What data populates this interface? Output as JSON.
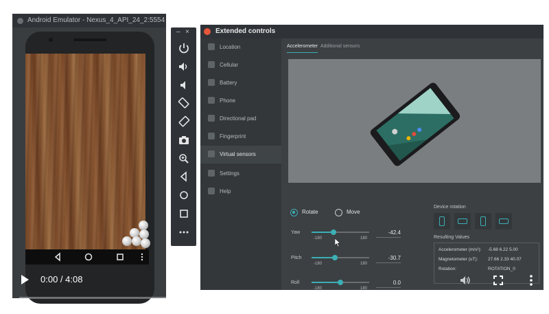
{
  "emulator": {
    "title": "Android Emulator - Nexus_4_API_24_2:5554"
  },
  "toolbar": {
    "minimize": "–",
    "close": "×",
    "buttons": [
      "power-icon",
      "volume-up-icon",
      "volume-down-icon",
      "rotate-left-icon",
      "rotate-right-icon",
      "camera-icon",
      "zoom-icon",
      "back-icon",
      "home-icon",
      "overview-icon",
      "more-icon"
    ]
  },
  "extended_controls": {
    "title": "Extended controls",
    "sidebar": [
      {
        "label": "Location",
        "icon": "location-icon"
      },
      {
        "label": "Cellular",
        "icon": "cellular-icon"
      },
      {
        "label": "Battery",
        "icon": "battery-icon"
      },
      {
        "label": "Phone",
        "icon": "phone-icon"
      },
      {
        "label": "Directional pad",
        "icon": "dpad-icon"
      },
      {
        "label": "Fingerprint",
        "icon": "fingerprint-icon"
      },
      {
        "label": "Virtual sensors",
        "icon": "virtual-sensors-icon",
        "active": true
      },
      {
        "label": "Settings",
        "icon": "settings-icon"
      },
      {
        "label": "Help",
        "icon": "help-icon"
      }
    ],
    "tabs": {
      "accelerometer": "Accelerometer",
      "additional": "Additional sensors"
    },
    "mode": {
      "rotate": "Rotate",
      "move": "Move",
      "selected": "rotate"
    },
    "sliders": {
      "yaw": {
        "label": "Yaw",
        "min": "-180",
        "max": "180",
        "value": "-42.4",
        "fraction": 0.38
      },
      "pitch": {
        "label": "Pitch",
        "min": "-180",
        "max": "180",
        "value": "-30.7",
        "fraction": 0.41
      },
      "roll": {
        "label": "Roll",
        "min": "-180",
        "max": "180",
        "value": "0.0",
        "fraction": 0.5
      }
    },
    "device_rotation": {
      "label": "Device rotation"
    },
    "resulting_values": {
      "label": "Resulting Values",
      "accelerometer": {
        "name": "Accelerometer (m/s²):",
        "value": "-5.68  6.22  5.00"
      },
      "magnetometer": {
        "name": "Magnetometer (uT):",
        "value": "27.66  2.33  40.07"
      },
      "rotation": {
        "name": "Rotation:",
        "value": "ROTATION_0"
      }
    }
  },
  "video": {
    "time": "0:00 / 4:08",
    "progress": 0.0
  },
  "colors": {
    "accent": "#3ab0b6",
    "close": "#e5563a",
    "progress": "#ff0000"
  }
}
